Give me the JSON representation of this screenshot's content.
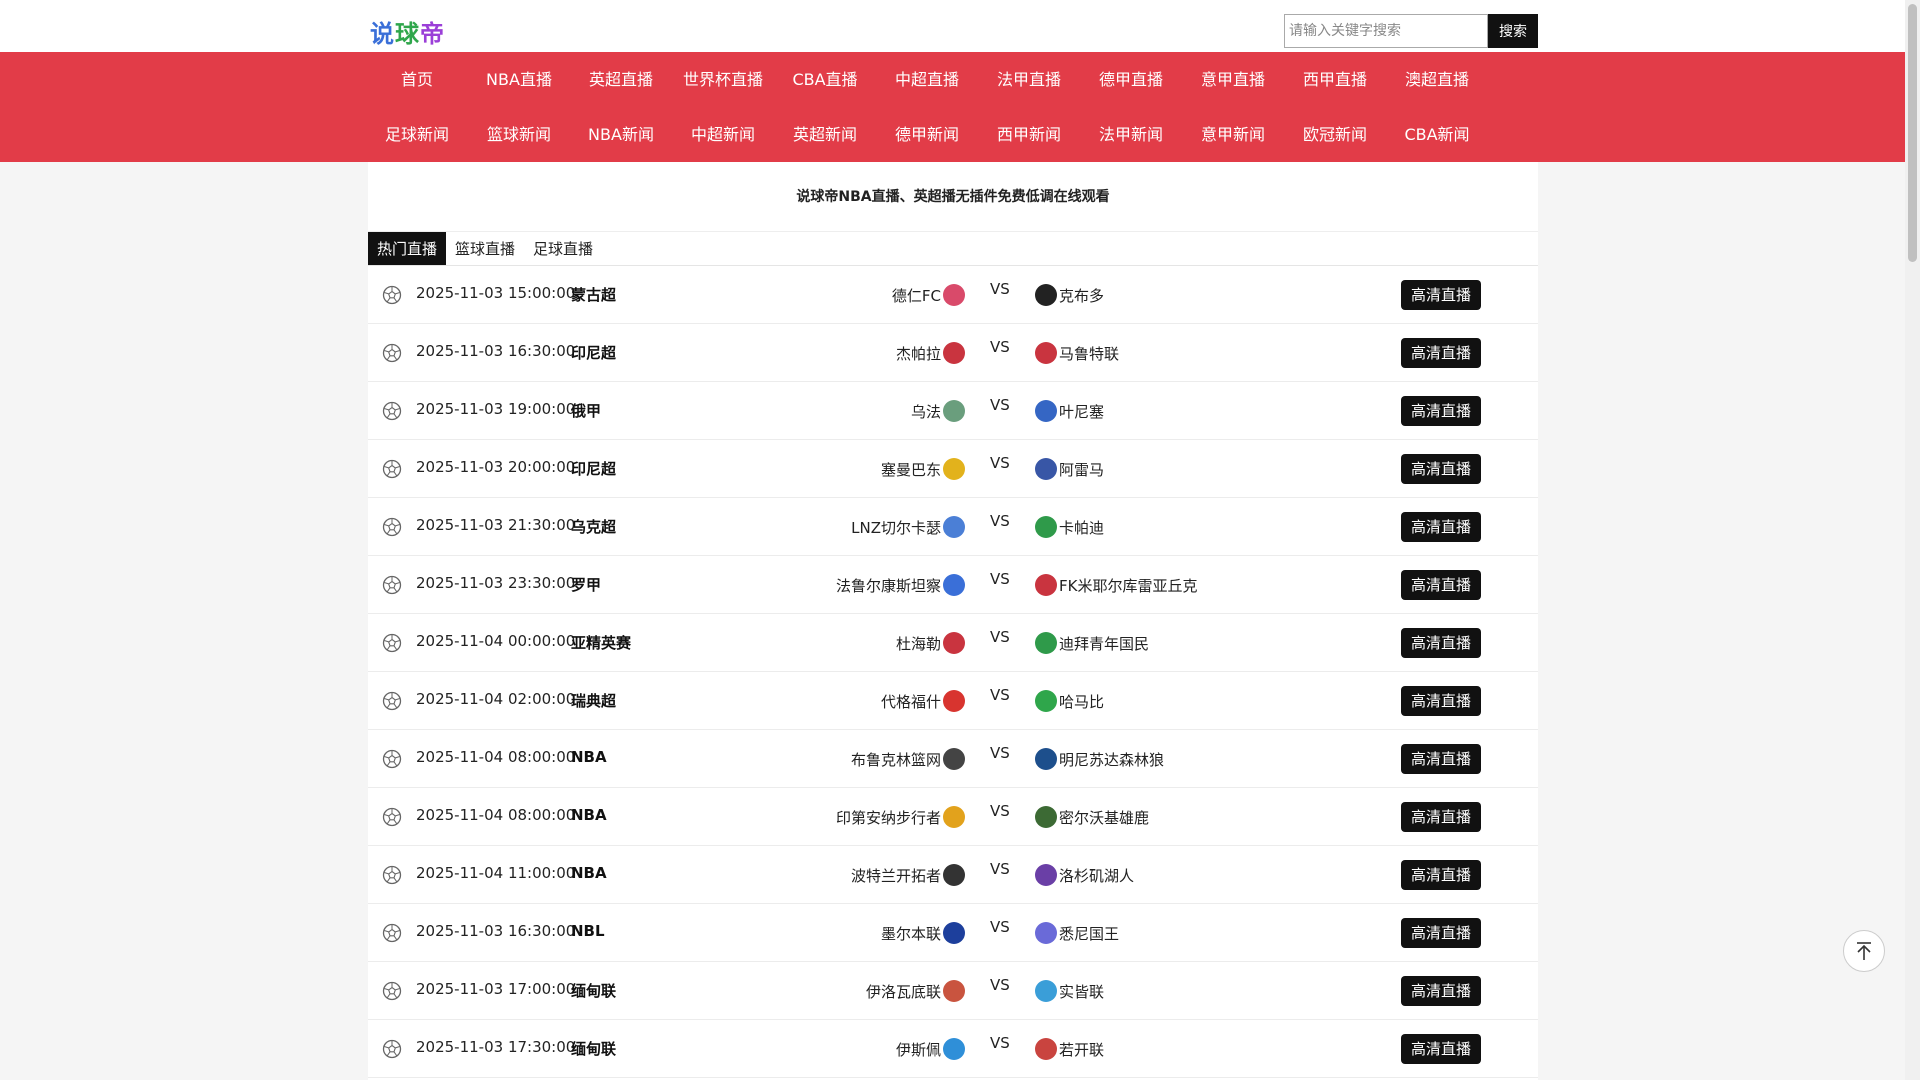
{
  "header": {
    "logo": [
      "说",
      "球",
      "帝"
    ],
    "search_placeholder": "请输入关键字搜索",
    "search_button": "搜索"
  },
  "nav": {
    "row1": [
      "首页",
      "NBA直播",
      "英超直播",
      "世界杯直播",
      "CBA直播",
      "中超直播",
      "法甲直播",
      "德甲直播",
      "意甲直播",
      "西甲直播",
      "澳超直播"
    ],
    "row2": [
      "足球新闻",
      "篮球新闻",
      "NBA新闻",
      "中超新闻",
      "英超新闻",
      "德甲新闻",
      "西甲新闻",
      "法甲新闻",
      "意甲新闻",
      "欧冠新闻",
      "CBA新闻"
    ]
  },
  "main": {
    "subtitle": "说球帝NBA直播、英超播无插件免费低调在线观看",
    "tabs": [
      "热门直播",
      "篮球直播",
      "足球直播"
    ],
    "vs_label": "VS",
    "watch_label": "高清直播",
    "matches": [
      {
        "time": "2025-11-03 15:00:00",
        "league": "蒙古超",
        "home": "德仁FC",
        "away": "克布多",
        "home_color": "#d94a6a",
        "away_color": "#222222"
      },
      {
        "time": "2025-11-03 16:30:00",
        "league": "印尼超",
        "home": "杰帕拉",
        "away": "马鲁特联",
        "home_color": "#c9343f",
        "away_color": "#c9343f"
      },
      {
        "time": "2025-11-03 19:00:00",
        "league": "俄甲",
        "home": "乌法",
        "away": "叶尼塞",
        "home_color": "#6a9e7d",
        "away_color": "#3566c4"
      },
      {
        "time": "2025-11-03 20:00:00",
        "league": "印尼超",
        "home": "塞曼巴东",
        "away": "阿雷马",
        "home_color": "#e2b21c",
        "away_color": "#3856a6"
      },
      {
        "time": "2025-11-03 21:30:00",
        "league": "乌克超",
        "home": "LNZ切尔卡瑟",
        "away": "卡帕迪",
        "home_color": "#4b7fd6",
        "away_color": "#2f9a4a"
      },
      {
        "time": "2025-11-03 23:30:00",
        "league": "罗甲",
        "home": "法鲁尔康斯坦察",
        "away": "FK米耶尔库雷亚丘克",
        "home_color": "#3a6fd8",
        "away_color": "#c9343f"
      },
      {
        "time": "2025-11-04 00:00:00",
        "league": "亚精英赛",
        "home": "杜海勒",
        "away": "迪拜青年国民",
        "home_color": "#c9343f",
        "away_color": "#2f9a4a"
      },
      {
        "time": "2025-11-04 02:00:00",
        "league": "瑞典超",
        "home": "代格福什",
        "away": "哈马比",
        "home_color": "#d8342f",
        "away_color": "#2fa64b"
      },
      {
        "time": "2025-11-04 08:00:00",
        "league": "NBA",
        "home": "布鲁克林篮网",
        "away": "明尼苏达森林狼",
        "home_color": "#444444",
        "away_color": "#1d4f8c"
      },
      {
        "time": "2025-11-04 08:00:00",
        "league": "NBA",
        "home": "印第安纳步行者",
        "away": "密尔沃基雄鹿",
        "home_color": "#e2a21c",
        "away_color": "#3c6a34"
      },
      {
        "time": "2025-11-04 11:00:00",
        "league": "NBA",
        "home": "波特兰开拓者",
        "away": "洛杉矶湖人",
        "home_color": "#333333",
        "away_color": "#6a3fa6"
      },
      {
        "time": "2025-11-03 16:30:00",
        "league": "NBL",
        "home": "墨尔本联",
        "away": "悉尼国王",
        "home_color": "#1d3f9c",
        "away_color": "#6a6ad8"
      },
      {
        "time": "2025-11-03 17:00:00",
        "league": "缅甸联",
        "home": "伊洛瓦底联",
        "away": "实皆联",
        "home_color": "#c9543f",
        "away_color": "#3a9ed8"
      },
      {
        "time": "2025-11-03 17:30:00",
        "league": "缅甸联",
        "home": "伊斯佩",
        "away": "若开联",
        "home_color": "#2f8fd8",
        "away_color": "#c9443f"
      }
    ]
  },
  "colors": {
    "nav_bg": "#e23c48",
    "button_bg": "#111111",
    "tab_active_bg": "#111111"
  },
  "icons": {
    "ball": "soccer-ball-icon",
    "back_to_top": "arrow-up-icon"
  }
}
